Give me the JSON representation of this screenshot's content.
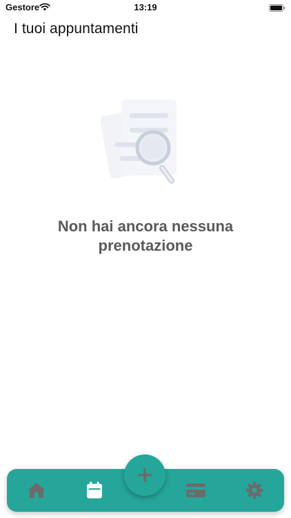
{
  "status_bar": {
    "carrier": "Gestore",
    "time": "13:19",
    "icons": [
      "wifi-icon",
      "battery-icon"
    ]
  },
  "page": {
    "title": "I tuoi appuntamenti"
  },
  "empty_state": {
    "illustration": "document-search-icon",
    "message": "Non hai ancora nessuna prenotazione"
  },
  "bottom_nav": {
    "background_color": "#26a69a",
    "active_icon_color": "#ffffff",
    "inactive_icon_color": "#6b6b6b",
    "active_item": "calendar",
    "items": [
      {
        "id": "home",
        "icon": "home-icon"
      },
      {
        "id": "calendar",
        "icon": "calendar-icon"
      },
      {
        "id": "add",
        "icon": "plus-icon"
      },
      {
        "id": "card",
        "icon": "credit-card-icon"
      },
      {
        "id": "settings",
        "icon": "gear-icon"
      }
    ]
  }
}
